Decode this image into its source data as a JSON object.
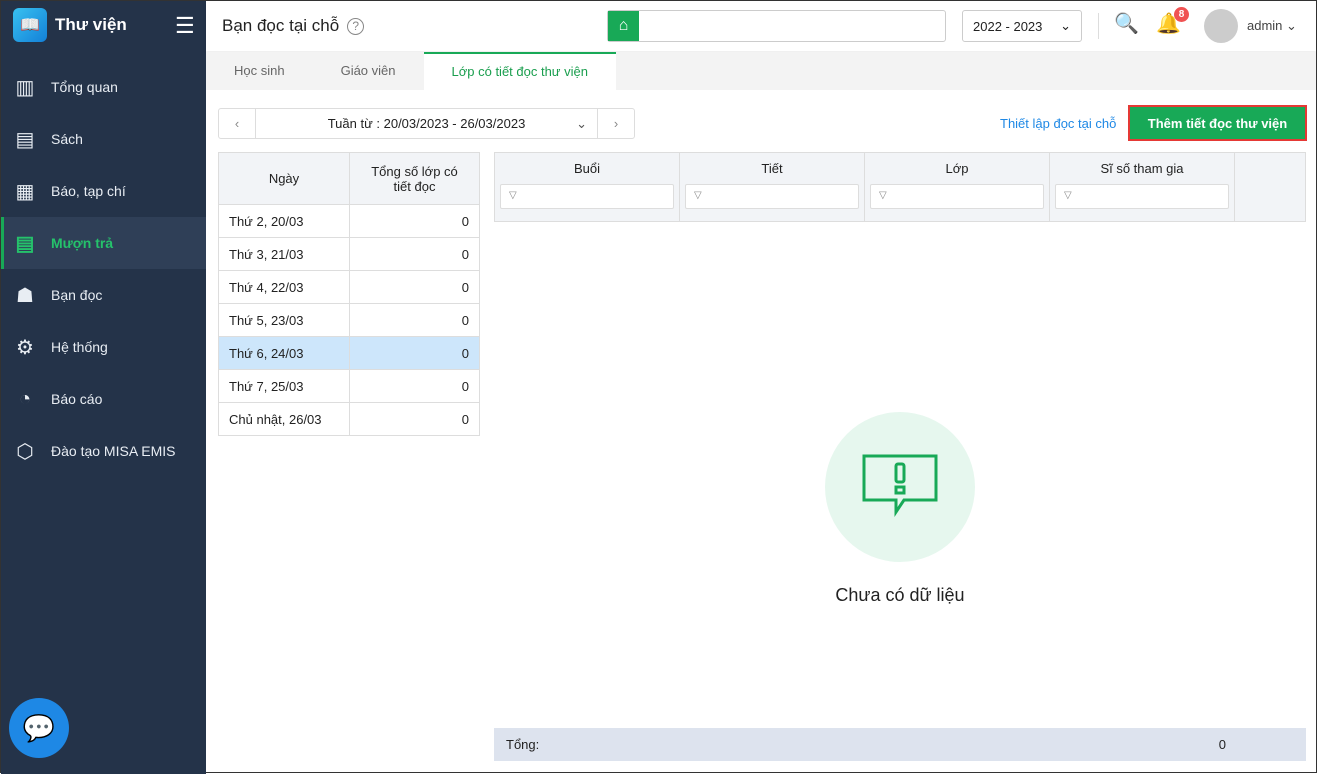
{
  "app": {
    "name": "Thư viện"
  },
  "sidebar": {
    "items": [
      {
        "label": "Tổng quan",
        "icon": "chart-icon"
      },
      {
        "label": "Sách",
        "icon": "book-icon"
      },
      {
        "label": "Báo, tạp chí",
        "icon": "newspaper-icon"
      },
      {
        "label": "Mượn trả",
        "icon": "borrow-icon"
      },
      {
        "label": "Bạn đọc",
        "icon": "reader-icon"
      },
      {
        "label": "Hệ thống",
        "icon": "gear-icon"
      },
      {
        "label": "Báo cáo",
        "icon": "pie-icon"
      },
      {
        "label": "Đào tạo MISA EMIS",
        "icon": "box-icon"
      }
    ]
  },
  "header": {
    "title": "Bạn đọc tại chỗ",
    "year": "2022 - 2023",
    "notif_count": "8",
    "user": "admin"
  },
  "tabs": [
    "Học sinh",
    "Giáo viên",
    "Lớp có tiết đọc thư viện"
  ],
  "toolbar": {
    "week": "Tuần từ : 20/03/2023 - 26/03/2023",
    "setup_link": "Thiết lập đọc tại chỗ",
    "add_button": "Thêm tiết đọc thư viện"
  },
  "days_table": {
    "headers": [
      "Ngày",
      "Tổng số lớp có tiết đọc"
    ],
    "rows": [
      [
        "Thứ 2, 20/03",
        "0"
      ],
      [
        "Thứ 3, 21/03",
        "0"
      ],
      [
        "Thứ 4, 22/03",
        "0"
      ],
      [
        "Thứ 5, 23/03",
        "0"
      ],
      [
        "Thứ 6, 24/03",
        "0"
      ],
      [
        "Thứ 7, 25/03",
        "0"
      ],
      [
        "Chủ nhật, 26/03",
        "0"
      ]
    ]
  },
  "grid": {
    "columns": [
      "Buổi",
      "Tiết",
      "Lớp",
      "Sĩ số tham gia"
    ],
    "empty": "Chưa có dữ liệu",
    "total_label": "Tổng:",
    "total_value": "0"
  }
}
